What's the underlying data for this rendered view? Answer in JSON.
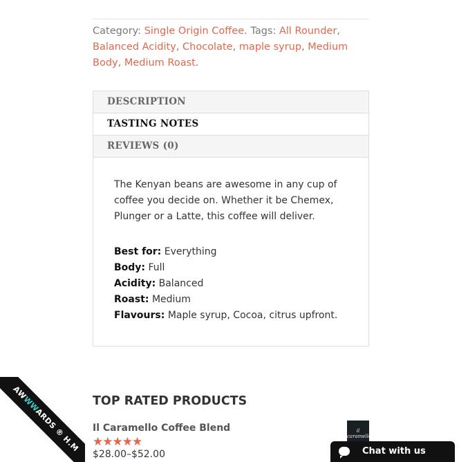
{
  "meta": {
    "category_label": "Category:",
    "category": "Single Origin Coffee",
    "tags_label": ". Tags:",
    "tags": [
      "All Rounder",
      "Balanced Acidity",
      "Chocolate",
      "maple syrup",
      "Medium Body",
      "Medium Roast"
    ],
    "end_punct": "."
  },
  "tabs": [
    {
      "label": "DESCRIPTION",
      "active": false
    },
    {
      "label": "TASTING NOTES",
      "active": true
    },
    {
      "label": "REVIEWS (0)",
      "active": false
    }
  ],
  "panel": {
    "intro": "The Kenyan beans are awesome in any cup of coffee you decide on. Whether it be Chemex, Plunger or a Latte, this coffee will deliver.",
    "rows": [
      {
        "key": "Best for:",
        "value": "Everything"
      },
      {
        "key": "Body:",
        "value": "Full"
      },
      {
        "key": "Acidity:",
        "value": "Balanced"
      },
      {
        "key": "Roast:",
        "value": "Medium"
      },
      {
        "key": "Flavours:",
        "value": "Maple syrup, Cocoa, citrus upfront."
      }
    ]
  },
  "top_rated": {
    "title": "TOP RATED PRODUCTS",
    "product": {
      "name": "Il Caramello Coffee Blend",
      "rating": 5,
      "stars": "★★★★★",
      "price": "$28.00–$52.00",
      "thumb_text": "il caramello"
    }
  },
  "ribbon": {
    "prefix": "AW",
    "accent": "WW",
    "suffix": "ARDS ® H.M"
  },
  "chat": {
    "label": "Chat with us",
    "icon": "chat-bubble-icon"
  },
  "colors": {
    "accent": "#e2674d",
    "dark": "#111111"
  }
}
